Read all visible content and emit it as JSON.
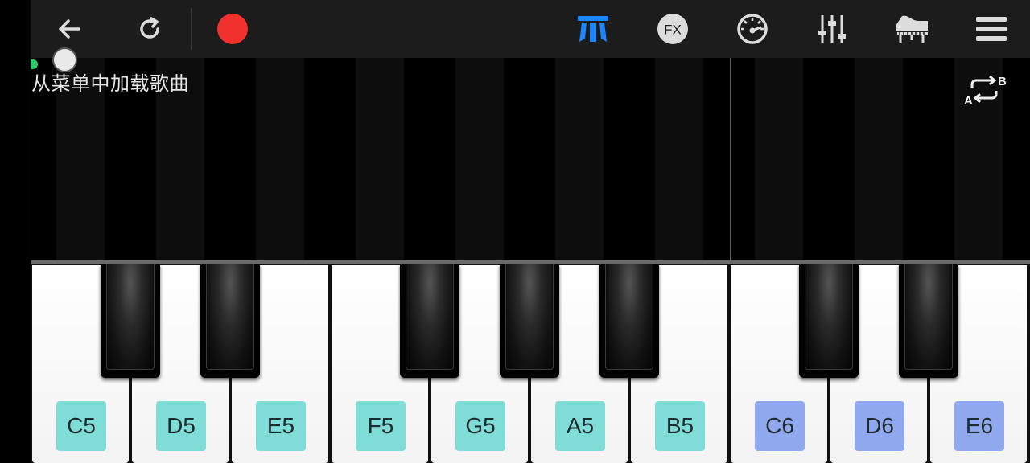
{
  "toolbar": {
    "buttons": [
      {
        "name": "back",
        "icon": "arrow-left-icon"
      },
      {
        "name": "reset",
        "icon": "refresh-icon"
      },
      {
        "name": "record",
        "icon": "record-dot-icon",
        "color": "#f2312c"
      },
      {
        "name": "piano-keys-mode",
        "icon": "keys-mode-icon",
        "color": "#1a86ff"
      },
      {
        "name": "fx",
        "icon": "fx-icon",
        "label": "FX"
      },
      {
        "name": "metronome",
        "icon": "speedometer-icon"
      },
      {
        "name": "mixer",
        "icon": "sliders-icon"
      },
      {
        "name": "instrument",
        "icon": "grand-piano-icon"
      },
      {
        "name": "menu",
        "icon": "hamburger-icon"
      }
    ]
  },
  "roll": {
    "hint": "从菜单中加载歌曲",
    "ab_loop": {
      "label_a": "A",
      "label_b": "B",
      "icon": "ab-repeat-icon"
    },
    "progress": 0
  },
  "keyboard": {
    "white_keys": [
      {
        "note": "C5",
        "label_color": "#80dcd6"
      },
      {
        "note": "D5",
        "label_color": "#80dcd6"
      },
      {
        "note": "E5",
        "label_color": "#80dcd6"
      },
      {
        "note": "F5",
        "label_color": "#80dcd6"
      },
      {
        "note": "G5",
        "label_color": "#80dcd6"
      },
      {
        "note": "A5",
        "label_color": "#80dcd6"
      },
      {
        "note": "B5",
        "label_color": "#80dcd6"
      },
      {
        "note": "C6",
        "label_color": "#8fa8ee"
      },
      {
        "note": "D6",
        "label_color": "#8fa8ee"
      },
      {
        "note": "E6",
        "label_color": "#8fa8ee"
      }
    ],
    "black_keys": [
      "C#5",
      "D#5",
      "F#5",
      "G#5",
      "A#5",
      "C#6",
      "D#6"
    ]
  },
  "colors": {
    "toolbar_bg": "#1c1c1c",
    "accent_blue": "#1a86ff",
    "record_red": "#f2312c",
    "octave5_label": "#80dcd6",
    "octave6_label": "#8fa8ee"
  }
}
